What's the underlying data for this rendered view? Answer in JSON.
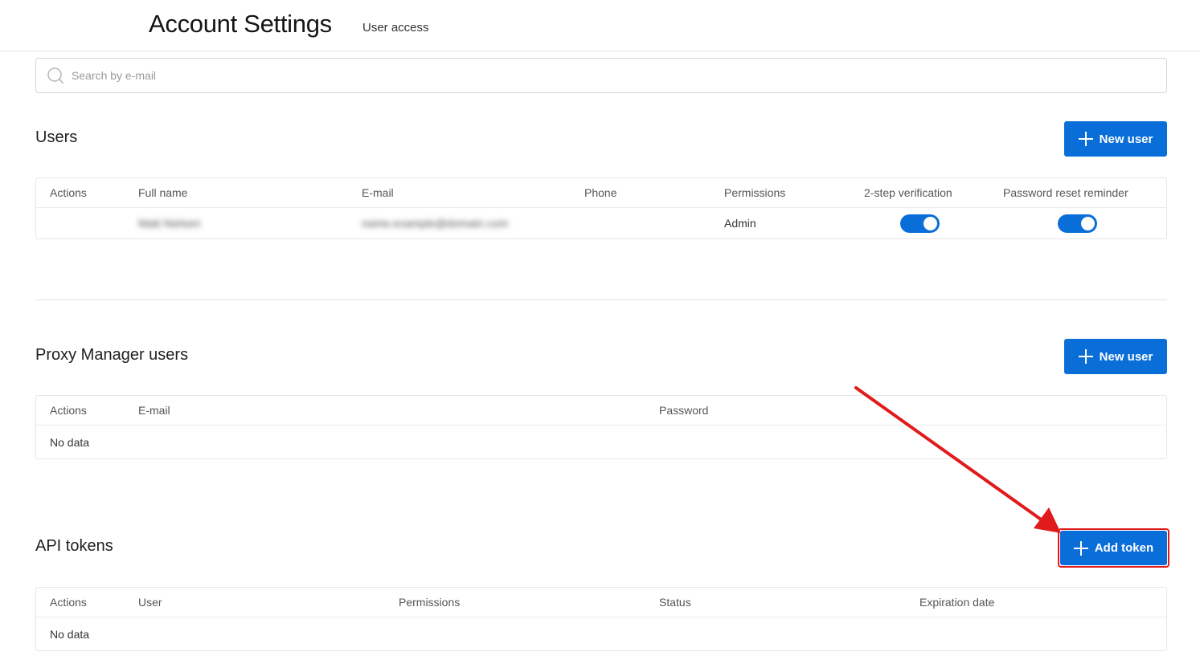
{
  "header": {
    "title": "Account Settings",
    "subtitle": "User access"
  },
  "search": {
    "placeholder": "Search by e-mail",
    "value": ""
  },
  "users": {
    "title": "Users",
    "new_button": "New user",
    "columns": [
      "Actions",
      "Full name",
      "E-mail",
      "Phone",
      "Permissions",
      "2-step verification",
      "Password reset reminder"
    ],
    "rows": [
      {
        "full_name": "Matt Nielsen",
        "email": "name.example@domain.com",
        "phone": "",
        "permissions": "Admin",
        "two_step_verification": true,
        "password_reset_reminder": true
      }
    ]
  },
  "proxy_manager_users": {
    "title": "Proxy Manager users",
    "new_button": "New user",
    "columns": [
      "Actions",
      "E-mail",
      "Password"
    ],
    "empty_text": "No data"
  },
  "api_tokens": {
    "title": "API tokens",
    "add_button": "Add token",
    "columns": [
      "Actions",
      "User",
      "Permissions",
      "Status",
      "Expiration date"
    ],
    "empty_text": "No data"
  },
  "colors": {
    "accent": "#0a6ed9",
    "annotation": "#e11b1b"
  }
}
